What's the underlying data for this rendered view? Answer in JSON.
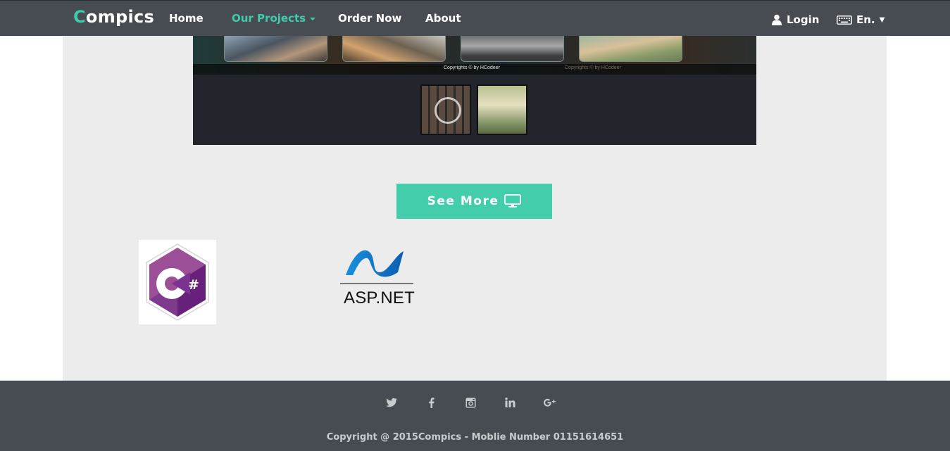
{
  "navbar": {
    "brand_first": "C",
    "brand_rest": "ompics",
    "links": [
      "Home",
      "Our Projects",
      "Order Now",
      "About"
    ],
    "login": "Login",
    "language": "En.",
    "accent": "#3fcca9"
  },
  "slider": {
    "caption": "Copyrights © by HCodeer",
    "caption_faint": "Copyrights © by HCodeer"
  },
  "main": {
    "see_more": "See More",
    "see_more_icon": "monitor-icon",
    "asp_label": "ASP.NET",
    "csharp_symbol": "#"
  },
  "footer": {
    "social": [
      "twitter-icon",
      "facebook-icon",
      "instagram-icon",
      "linkedin-icon",
      "google-plus-icon"
    ],
    "copyright": "Copyright @ 2015Compics - Moblie Number 01151614651"
  }
}
